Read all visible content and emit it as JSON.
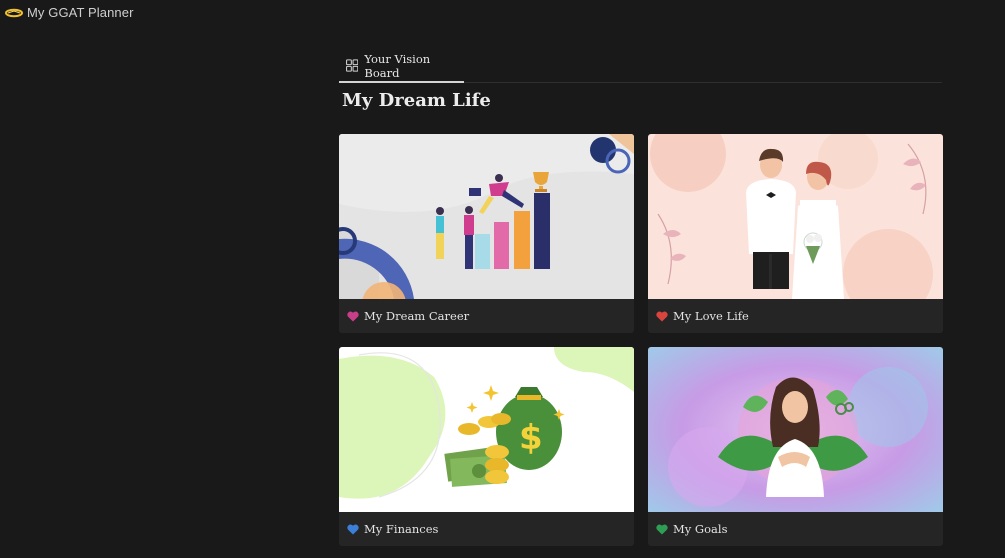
{
  "app": {
    "title": "My GGAT Planner"
  },
  "tabs": [
    {
      "label": "Your Vision Board",
      "icon": "gallery-grid-icon",
      "active": true
    }
  ],
  "page": {
    "title": "My Dream Life"
  },
  "cards": [
    {
      "label": "My Dream Career",
      "heart_color": "#c73f8a",
      "icon": "pink-heart-icon"
    },
    {
      "label": "My Love Life",
      "heart_color": "#d9443f",
      "icon": "red-heart-icon"
    },
    {
      "label": "My Finances",
      "heart_color": "#3b7fd8",
      "icon": "blue-heart-icon"
    },
    {
      "label": "My Goals",
      "heart_color": "#2f9e55",
      "icon": "green-heart-icon"
    }
  ]
}
